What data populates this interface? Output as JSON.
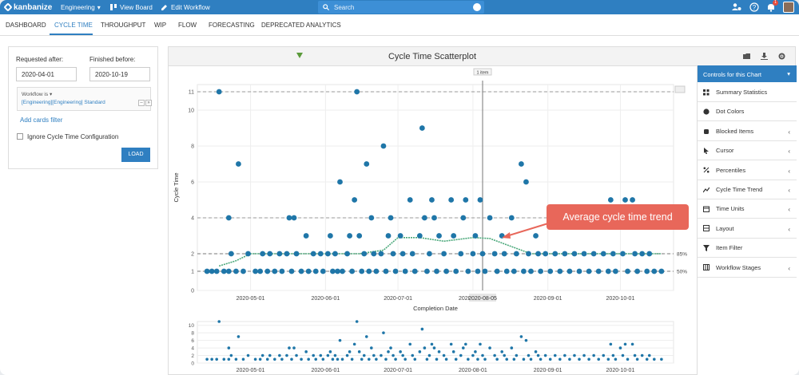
{
  "topbar": {
    "logo": "kanbanize",
    "workspace": "Engineering",
    "view_board": "View Board",
    "edit_workflow": "Edit Workflow",
    "search_placeholder": "Search",
    "notification_count": "1"
  },
  "tabs": [
    "DASHBOARD",
    "CYCLE TIME",
    "THROUGHPUT",
    "WIP",
    "FLOW",
    "FORECASTING",
    "DEPRECATED ANALYTICS"
  ],
  "active_tab": "CYCLE TIME",
  "filters": {
    "requested_after_label": "Requested after:",
    "requested_after_value": "2020-04-01",
    "finished_before_label": "Finished before:",
    "finished_before_value": "2020-10-19",
    "workflow_label": "Workflow",
    "workflow_op": "is",
    "workflow_value": "[Engineering][Engineering] Standard",
    "add_filter": "Add cards filter",
    "ignore_config": "Ignore Cycle Time Configuration",
    "load_button": "LOAD"
  },
  "chart_panel": {
    "title": "Cycle Time Scatterplot",
    "tooltip": "1 item",
    "callout": "Average cycle time trend"
  },
  "controls": {
    "header": "Controls for this Chart",
    "items": [
      {
        "label": "Summary Statistics",
        "icon": "grid-icon",
        "chevron": false
      },
      {
        "label": "Dot Colors",
        "icon": "dot-icon",
        "chevron": false
      },
      {
        "label": "Blocked Items",
        "icon": "hand-icon",
        "chevron": true
      },
      {
        "label": "Cursor",
        "icon": "cursor-icon",
        "chevron": true
      },
      {
        "label": "Percentiles",
        "icon": "percent-icon",
        "chevron": true
      },
      {
        "label": "Cycle Time Trend",
        "icon": "trend-icon",
        "chevron": true
      },
      {
        "label": "Time Units",
        "icon": "calendar-icon",
        "chevron": true
      },
      {
        "label": "Layout",
        "icon": "layout-icon",
        "chevron": true
      },
      {
        "label": "Item Filter",
        "icon": "filter-icon",
        "chevron": false
      },
      {
        "label": "Workflow Stages",
        "icon": "table-icon",
        "chevron": true
      }
    ]
  },
  "chart_data": {
    "type": "scatter",
    "xlabel": "Completion Date",
    "ylabel": "Cycle Time",
    "y_ticks": [
      0,
      1,
      2,
      4,
      6,
      8,
      10,
      11
    ],
    "x_ticks": [
      "2020-05-01",
      "2020-06-01",
      "2020-07-01",
      "2020-08-01",
      "2020-09-01",
      "2020-10-01"
    ],
    "cursor_label": "2020-08-05",
    "percentile_labels": [
      "85%",
      "50%"
    ],
    "percentile_values": [
      2,
      1
    ],
    "points": [
      [
        "2020-04-13",
        1
      ],
      [
        "2020-04-15",
        1
      ],
      [
        "2020-04-17",
        1
      ],
      [
        "2020-04-18",
        11
      ],
      [
        "2020-04-20",
        1
      ],
      [
        "2020-04-22",
        1
      ],
      [
        "2020-04-22",
        4
      ],
      [
        "2020-04-23",
        2
      ],
      [
        "2020-04-25",
        1
      ],
      [
        "2020-04-26",
        7
      ],
      [
        "2020-04-28",
        1
      ],
      [
        "2020-04-30",
        2
      ],
      [
        "2020-05-03",
        1
      ],
      [
        "2020-05-05",
        1
      ],
      [
        "2020-05-06",
        2
      ],
      [
        "2020-05-08",
        1
      ],
      [
        "2020-05-09",
        2
      ],
      [
        "2020-05-11",
        1
      ],
      [
        "2020-05-13",
        2
      ],
      [
        "2020-05-14",
        1
      ],
      [
        "2020-05-16",
        2
      ],
      [
        "2020-05-17",
        4
      ],
      [
        "2020-05-18",
        1
      ],
      [
        "2020-05-19",
        4
      ],
      [
        "2020-05-20",
        2
      ],
      [
        "2020-05-22",
        1
      ],
      [
        "2020-05-24",
        3
      ],
      [
        "2020-05-25",
        1
      ],
      [
        "2020-05-27",
        2
      ],
      [
        "2020-05-28",
        1
      ],
      [
        "2020-05-30",
        2
      ],
      [
        "2020-05-31",
        1
      ],
      [
        "2020-06-02",
        2
      ],
      [
        "2020-06-03",
        3
      ],
      [
        "2020-06-04",
        1
      ],
      [
        "2020-06-05",
        2
      ],
      [
        "2020-06-06",
        1
      ],
      [
        "2020-06-07",
        6
      ],
      [
        "2020-06-08",
        1
      ],
      [
        "2020-06-10",
        2
      ],
      [
        "2020-06-11",
        3
      ],
      [
        "2020-06-12",
        1
      ],
      [
        "2020-06-13",
        5
      ],
      [
        "2020-06-14",
        11
      ],
      [
        "2020-06-15",
        3
      ],
      [
        "2020-06-16",
        1
      ],
      [
        "2020-06-17",
        2
      ],
      [
        "2020-06-18",
        7
      ],
      [
        "2020-06-19",
        1
      ],
      [
        "2020-06-20",
        4
      ],
      [
        "2020-06-21",
        2
      ],
      [
        "2020-06-22",
        1
      ],
      [
        "2020-06-24",
        2
      ],
      [
        "2020-06-25",
        8
      ],
      [
        "2020-06-26",
        1
      ],
      [
        "2020-06-27",
        3
      ],
      [
        "2020-06-28",
        4
      ],
      [
        "2020-06-29",
        2
      ],
      [
        "2020-06-30",
        1
      ],
      [
        "2020-07-02",
        3
      ],
      [
        "2020-07-03",
        2
      ],
      [
        "2020-07-04",
        1
      ],
      [
        "2020-07-06",
        5
      ],
      [
        "2020-07-07",
        2
      ],
      [
        "2020-07-08",
        1
      ],
      [
        "2020-07-10",
        3
      ],
      [
        "2020-07-11",
        9
      ],
      [
        "2020-07-12",
        4
      ],
      [
        "2020-07-13",
        1
      ],
      [
        "2020-07-14",
        2
      ],
      [
        "2020-07-15",
        5
      ],
      [
        "2020-07-16",
        4
      ],
      [
        "2020-07-17",
        1
      ],
      [
        "2020-07-18",
        3
      ],
      [
        "2020-07-20",
        2
      ],
      [
        "2020-07-21",
        1
      ],
      [
        "2020-07-23",
        5
      ],
      [
        "2020-07-24",
        3
      ],
      [
        "2020-07-25",
        1
      ],
      [
        "2020-07-27",
        2
      ],
      [
        "2020-07-28",
        4
      ],
      [
        "2020-07-29",
        5
      ],
      [
        "2020-07-30",
        1
      ],
      [
        "2020-08-01",
        2
      ],
      [
        "2020-08-02",
        3
      ],
      [
        "2020-08-03",
        1
      ],
      [
        "2020-08-04",
        5
      ],
      [
        "2020-08-05",
        2
      ],
      [
        "2020-08-06",
        1
      ],
      [
        "2020-08-08",
        4
      ],
      [
        "2020-08-10",
        2
      ],
      [
        "2020-08-11",
        1
      ],
      [
        "2020-08-13",
        3
      ],
      [
        "2020-08-14",
        2
      ],
      [
        "2020-08-15",
        1
      ],
      [
        "2020-08-17",
        4
      ],
      [
        "2020-08-18",
        1
      ],
      [
        "2020-08-19",
        2
      ],
      [
        "2020-08-21",
        7
      ],
      [
        "2020-08-22",
        1
      ],
      [
        "2020-08-23",
        6
      ],
      [
        "2020-08-24",
        2
      ],
      [
        "2020-08-25",
        1
      ],
      [
        "2020-08-27",
        3
      ],
      [
        "2020-08-28",
        2
      ],
      [
        "2020-08-29",
        1
      ],
      [
        "2020-08-31",
        2
      ],
      [
        "2020-09-02",
        1
      ],
      [
        "2020-09-04",
        2
      ],
      [
        "2020-09-06",
        1
      ],
      [
        "2020-09-08",
        2
      ],
      [
        "2020-09-10",
        1
      ],
      [
        "2020-09-12",
        2
      ],
      [
        "2020-09-14",
        1
      ],
      [
        "2020-09-16",
        2
      ],
      [
        "2020-09-18",
        1
      ],
      [
        "2020-09-20",
        2
      ],
      [
        "2020-09-22",
        1
      ],
      [
        "2020-09-24",
        2
      ],
      [
        "2020-09-26",
        1
      ],
      [
        "2020-09-27",
        5
      ],
      [
        "2020-09-28",
        2
      ],
      [
        "2020-09-29",
        1
      ],
      [
        "2020-10-01",
        4
      ],
      [
        "2020-10-02",
        2
      ],
      [
        "2020-10-03",
        5
      ],
      [
        "2020-10-04",
        1
      ],
      [
        "2020-10-06",
        5
      ],
      [
        "2020-10-07",
        2
      ],
      [
        "2020-10-08",
        1
      ],
      [
        "2020-10-10",
        2
      ],
      [
        "2020-10-12",
        1
      ],
      [
        "2020-10-13",
        2
      ],
      [
        "2020-10-15",
        1
      ],
      [
        "2020-10-18",
        1
      ]
    ],
    "trend": [
      [
        "2020-04-18",
        1.3
      ],
      [
        "2020-04-25",
        1.6
      ],
      [
        "2020-05-01",
        2
      ],
      [
        "2020-05-15",
        2
      ],
      [
        "2020-06-01",
        2
      ],
      [
        "2020-06-15",
        2
      ],
      [
        "2020-06-25",
        2.2
      ],
      [
        "2020-07-01",
        2.9
      ],
      [
        "2020-07-10",
        2.9
      ],
      [
        "2020-07-20",
        2.7
      ],
      [
        "2020-08-01",
        2.9
      ],
      [
        "2020-08-08",
        2.85
      ],
      [
        "2020-08-15",
        2.5
      ],
      [
        "2020-08-25",
        2
      ],
      [
        "2020-09-10",
        2
      ],
      [
        "2020-10-01",
        2
      ],
      [
        "2020-10-18",
        2
      ]
    ]
  }
}
